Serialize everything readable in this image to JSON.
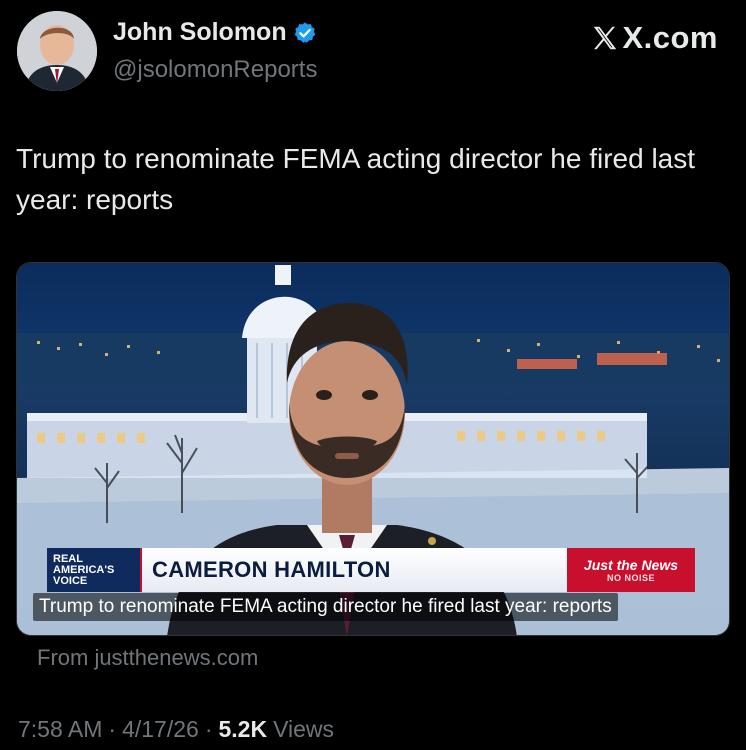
{
  "author": {
    "display_name": "John Solomon",
    "handle": "@jsolomonReports",
    "verified_icon": "verified-badge-icon",
    "avatar": "avatar"
  },
  "brand": {
    "text": "X.com",
    "icon": "x-logo-icon"
  },
  "tweet": {
    "text": "Trump to renominate FEMA acting director he fired last year: reports"
  },
  "media": {
    "network_logo_lines": [
      "REAL",
      "AMERICA'S",
      "VOICE"
    ],
    "name_plate": "CAMERON HAMILTON",
    "show_logo": "Just the News",
    "show_logo_sub": "NO NOISE",
    "caption": "Trump to renominate FEMA acting director he fired last year: reports"
  },
  "source": {
    "text": "From justthenews.com"
  },
  "meta": {
    "time": "7:58 AM",
    "separator": "·",
    "date": "4/17/26",
    "views_count": "5.2K",
    "views_label": "Views"
  },
  "colors": {
    "background": "#000000",
    "primary_text": "#e7e9ea",
    "secondary_text": "#71767b",
    "verified": "#1d9bf0",
    "network_blue": "#0f2a5c",
    "network_red": "#c8102e"
  }
}
